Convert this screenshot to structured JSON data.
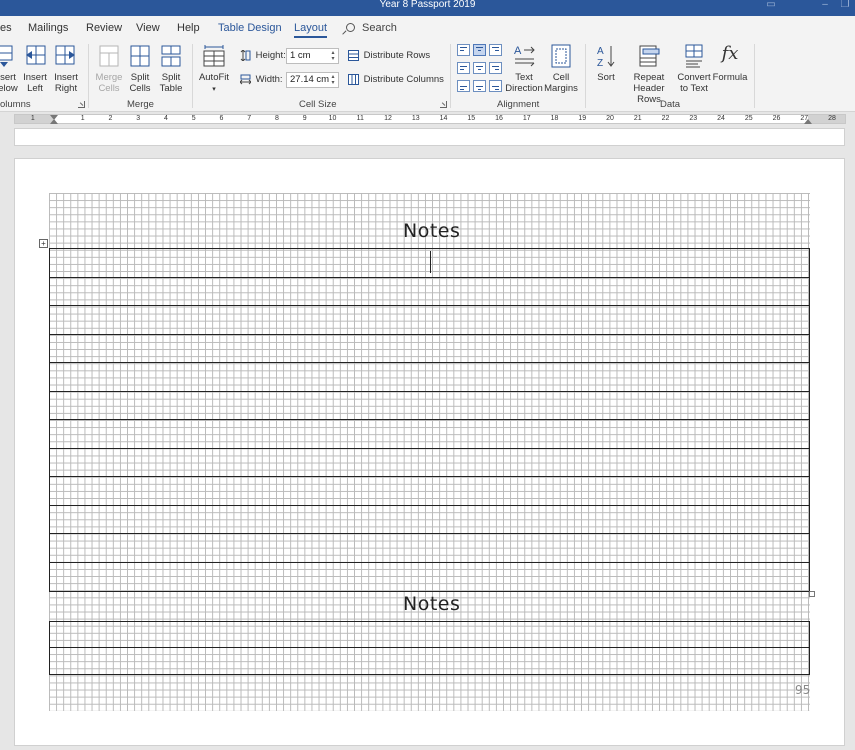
{
  "window": {
    "title": "Year 8 Passport 2019"
  },
  "tabs": [
    {
      "label": "es"
    },
    {
      "label": "Mailings"
    },
    {
      "label": "Review"
    },
    {
      "label": "View"
    },
    {
      "label": "Help"
    },
    {
      "label": "Table Design"
    },
    {
      "label": "Layout"
    }
  ],
  "search": {
    "label": "Search"
  },
  "ribbon": {
    "rows_columns": {
      "insert_below": {
        "line1": "sert",
        "line2": "elow"
      },
      "insert_left": {
        "line1": "Insert",
        "line2": "Left"
      },
      "insert_right": {
        "line1": "Insert",
        "line2": "Right"
      },
      "group_label": "olumns"
    },
    "merge": {
      "merge_cells": {
        "line1": "Merge",
        "line2": "Cells"
      },
      "split_cells": {
        "line1": "Split",
        "line2": "Cells"
      },
      "split_table": {
        "line1": "Split",
        "line2": "Table"
      },
      "group_label": "Merge"
    },
    "cell_size": {
      "autofit": "AutoFit",
      "height_label": "Height:",
      "height_value": "1 cm",
      "width_label": "Width:",
      "width_value": "27.14 cm",
      "distribute_rows": "Distribute Rows",
      "distribute_columns": "Distribute Columns",
      "group_label": "Cell Size"
    },
    "alignment": {
      "text_direction": {
        "line1": "Text",
        "line2": "Direction"
      },
      "cell_margins": {
        "line1": "Cell",
        "line2": "Margins"
      },
      "group_label": "Alignment"
    },
    "data": {
      "sort": "Sort",
      "repeat_header_rows": {
        "line1": "Repeat",
        "line2": "Header Rows"
      },
      "convert_to_text": {
        "line1": "Convert",
        "line2": "to Text"
      },
      "formula": "Formula",
      "formula_glyph": "fx",
      "group_label": "Data"
    }
  },
  "ruler": {
    "labels": [
      "1",
      "1",
      "2",
      "3",
      "4",
      "5",
      "6",
      "7",
      "8",
      "9",
      "10",
      "11",
      "12",
      "13",
      "14",
      "15",
      "16",
      "17",
      "18",
      "19",
      "20",
      "21",
      "22",
      "23",
      "24",
      "25",
      "26",
      "27",
      "28"
    ]
  },
  "document": {
    "heading_1": "Notes",
    "heading_2": "Notes",
    "page_number": "95",
    "table_1_rows": 12,
    "table_2_rows": 2
  },
  "colors": {
    "accent": "#2b579a",
    "ribbon_bg": "#f3f3f3",
    "workspace": "#e6e6e6"
  }
}
